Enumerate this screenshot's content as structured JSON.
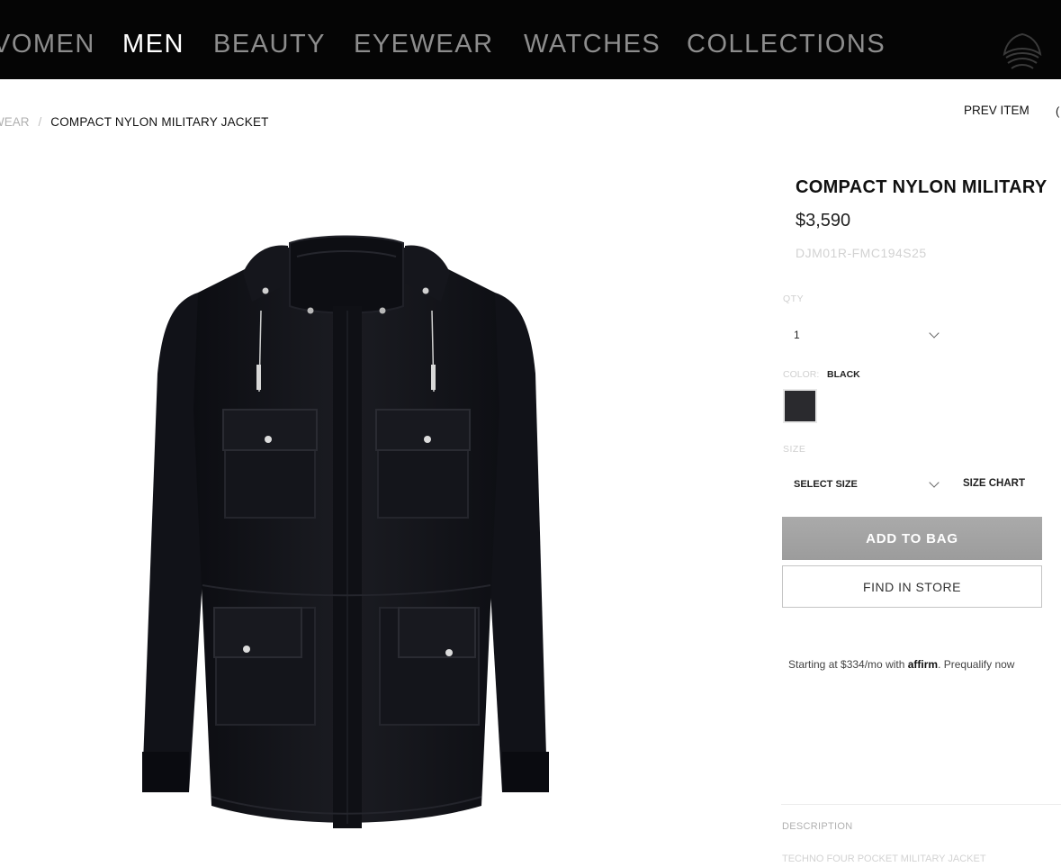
{
  "nav": {
    "items": [
      {
        "label": "VOMEN"
      },
      {
        "label": "MEN"
      },
      {
        "label": "BEAUTY"
      },
      {
        "label": "EYEWEAR"
      },
      {
        "label": "WATCHES"
      },
      {
        "label": "COLLECTIONS"
      }
    ],
    "active": "MEN",
    "logo_icon": "eagle-logo-icon"
  },
  "breadcrumb": {
    "previous": "WEAR",
    "separator": "/",
    "current": "COMPACT NYLON MILITARY JACKET"
  },
  "pager": {
    "prev_label": "PREV ITEM"
  },
  "product": {
    "title": "COMPACT NYLON MILITARY",
    "price": "$3,590",
    "sku": "DJM01R-FMC194S25",
    "image_icon": "jacket-product-image"
  },
  "options": {
    "qty_label": "QTY",
    "qty_value": "1",
    "color_label": "COLOR:",
    "color_value": "BLACK",
    "swatch_color": "#2a2a2e",
    "size_label": "SIZE",
    "size_value": "SELECT SIZE",
    "size_chart_label": "SIZE CHART"
  },
  "actions": {
    "add_to_bag": "ADD TO BAG",
    "find_in_store": "FIND IN STORE"
  },
  "financing": {
    "text_before": "Starting at $334/mo with",
    "brand": "affirm",
    "text_after": ". Prequalify now"
  },
  "description": {
    "label": "DESCRIPTION",
    "text": "TECHNO FOUR POCKET MILITARY JACKET"
  },
  "colors": {
    "nav_bg": "#050505",
    "nav_active": "#ffffff",
    "nav_inactive": "#8d8d8d",
    "add_button": "#a4a4a4"
  }
}
